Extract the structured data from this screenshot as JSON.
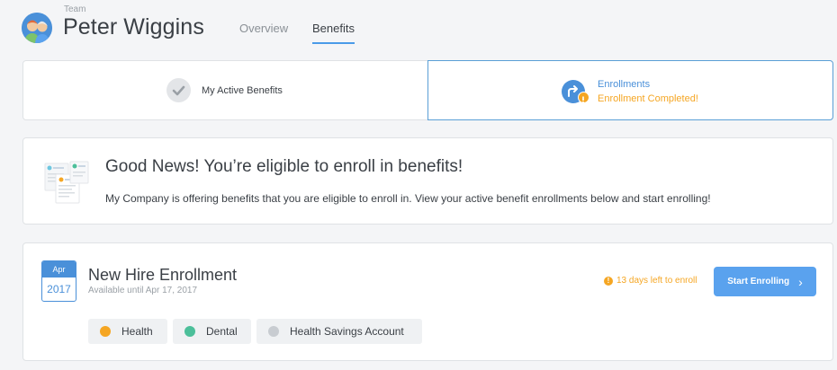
{
  "header": {
    "team_label": "Team",
    "name": "Peter Wiggins",
    "tabs": [
      {
        "label": "Overview",
        "active": false
      },
      {
        "label": "Benefits",
        "active": true
      }
    ],
    "accent": "#4a9be8"
  },
  "summary_cards": {
    "active": {
      "label": "My Active Benefits",
      "icon": "checkmark-icon"
    },
    "enrollments": {
      "title": "Enrollments",
      "status": "Enrollment Completed!",
      "icon": "enrollment-arrow-icon",
      "status_color": "#f5a623"
    }
  },
  "news": {
    "title": "Good News! You’re eligible to enroll in benefits!",
    "description": "My Company is offering benefits that you are eligible to enroll in. View your active benefit enrollments below and start enrolling!"
  },
  "enrollment": {
    "calendar": {
      "month": "Apr",
      "year": "2017"
    },
    "title": "New Hire Enrollment",
    "available": "Available until Apr 17, 2017",
    "days_left": "13 days left to enroll",
    "button_label": "Start Enrolling",
    "benefits": [
      {
        "label": "Health",
        "icon": "health-icon",
        "color": "#f5a623"
      },
      {
        "label": "Dental",
        "icon": "tooth-icon",
        "color": "#4cbf9a"
      },
      {
        "label": "Health Savings Account",
        "icon": "umbrella-icon",
        "color": "#b7bcc2"
      }
    ]
  }
}
